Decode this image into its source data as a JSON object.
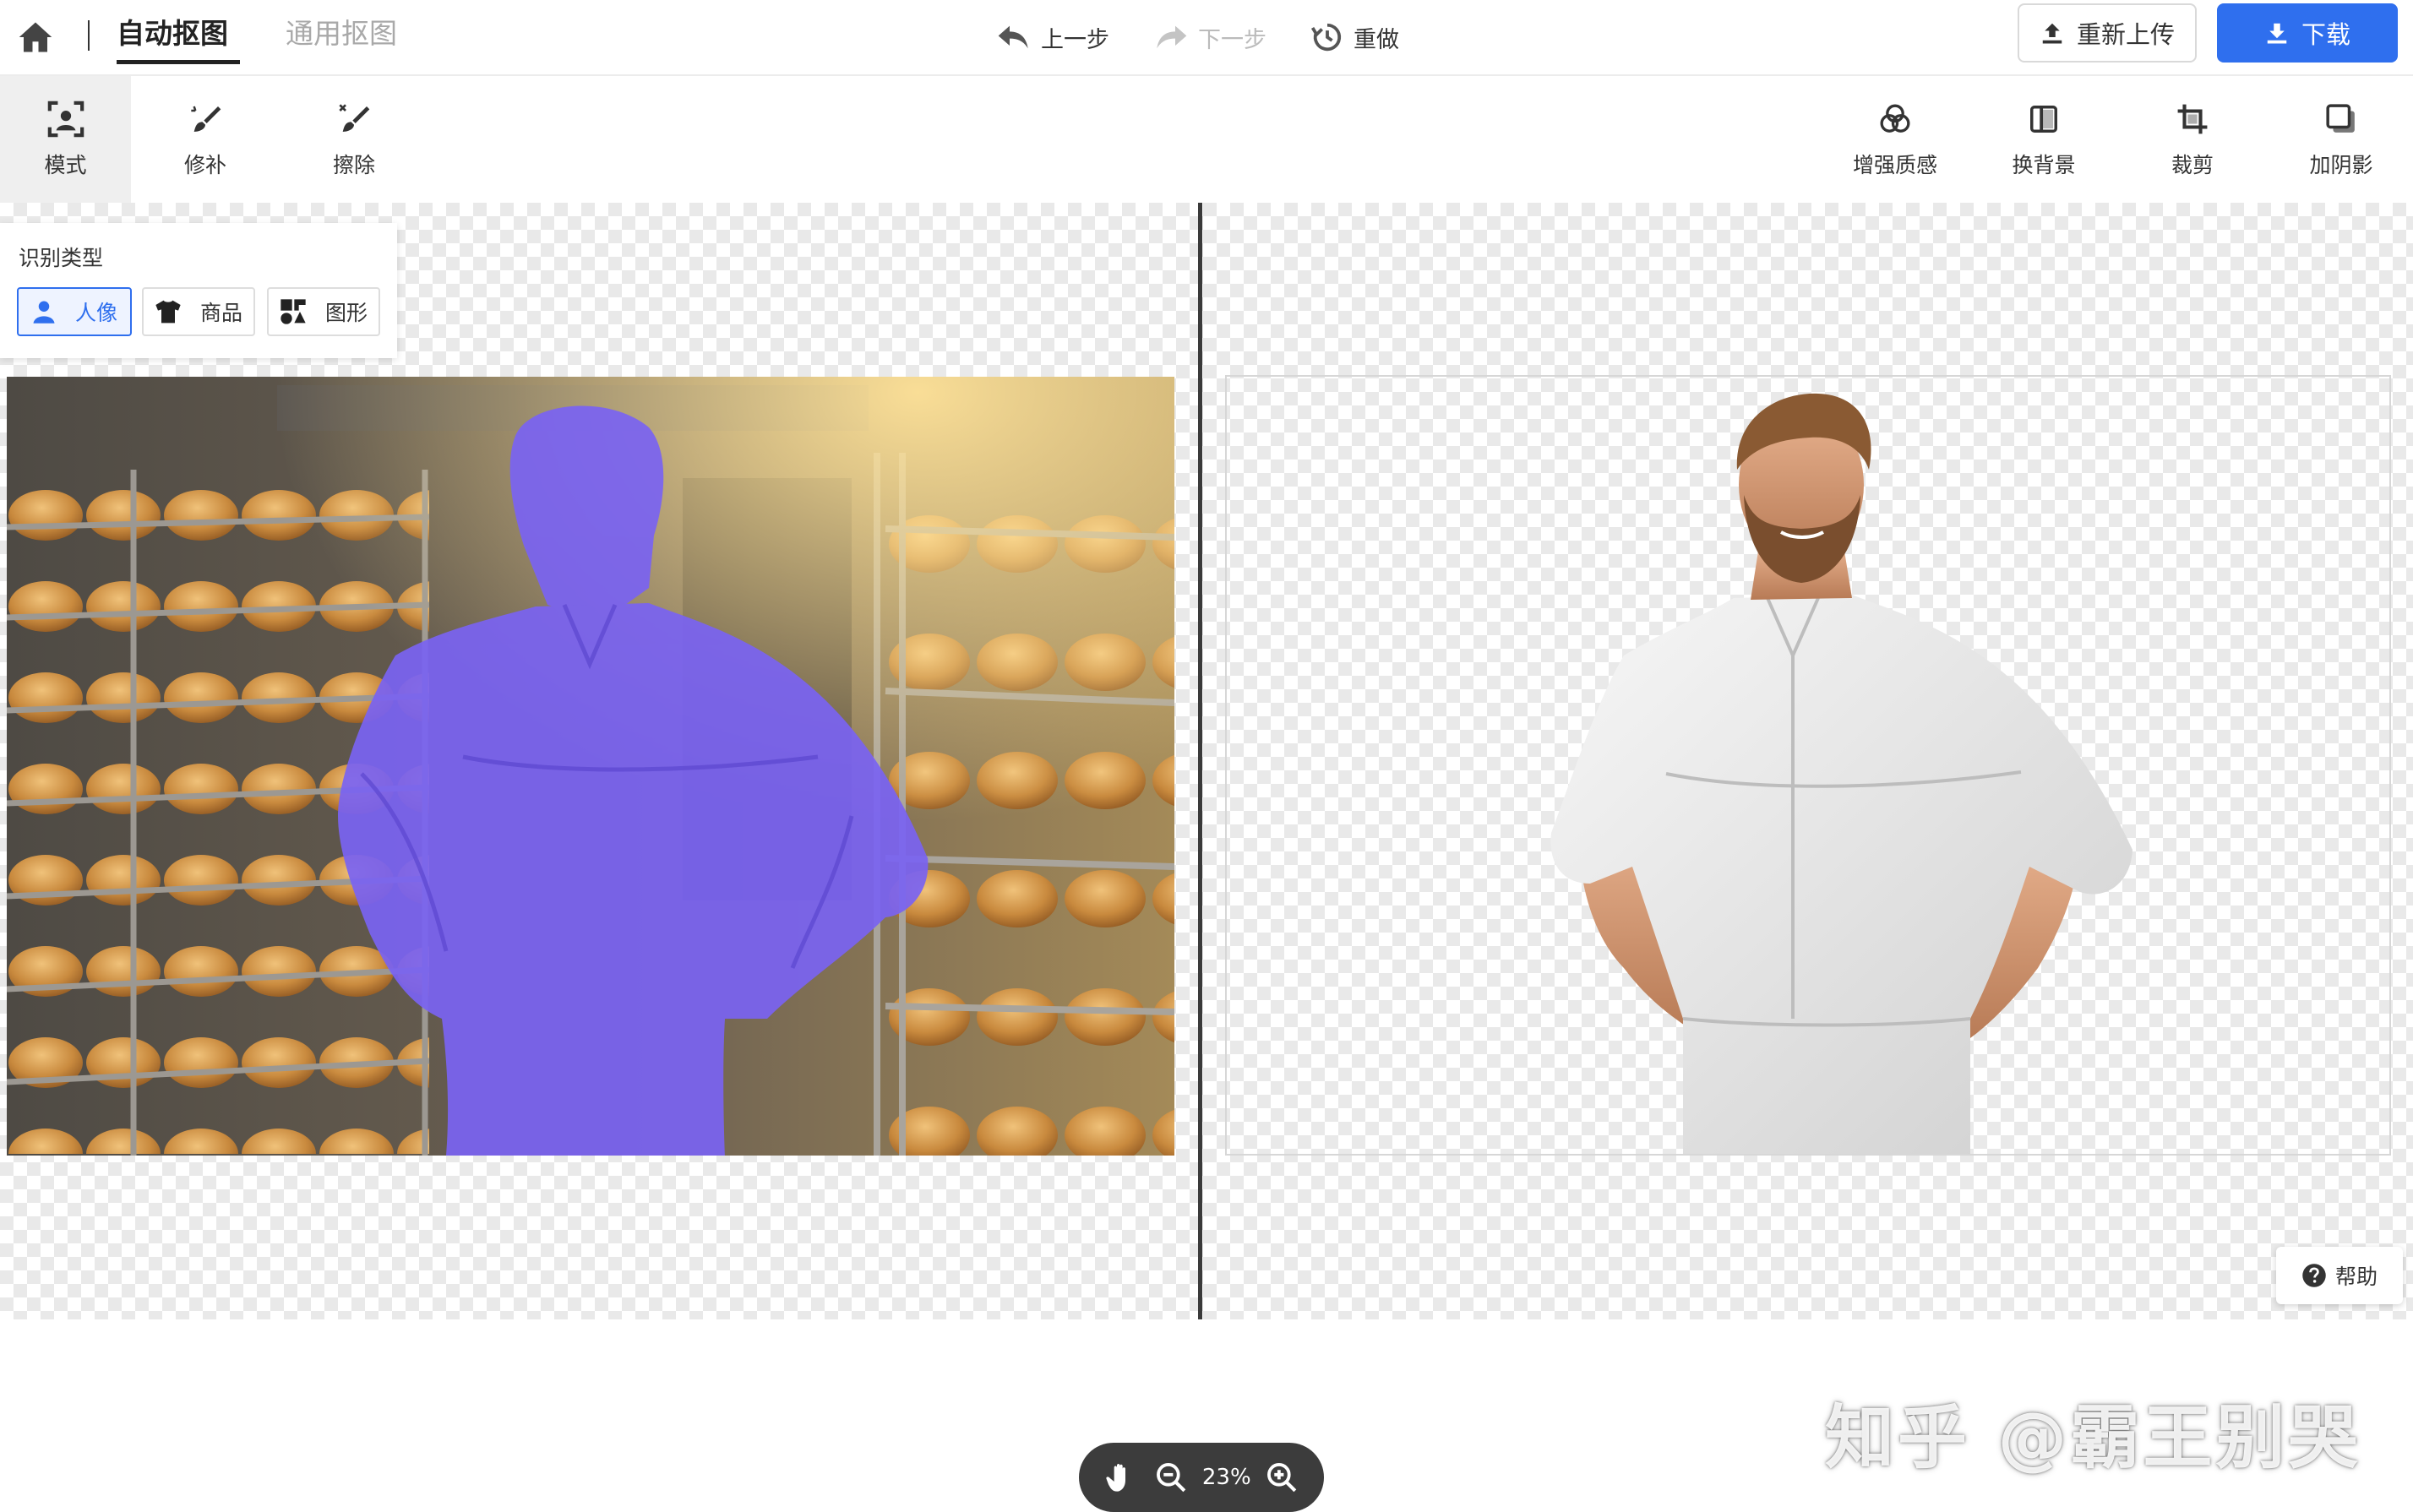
{
  "header": {
    "tabs": [
      {
        "label": "自动抠图",
        "active": true
      },
      {
        "label": "通用抠图",
        "active": false
      }
    ],
    "undo_label": "上一步",
    "redo_label": "下一步",
    "reset_label": "重做",
    "reupload_label": "重新上传",
    "download_label": "下载",
    "accent_color": "#2f6fee"
  },
  "toolbar": {
    "left_tools": [
      {
        "label": "模式",
        "icon": "portrait-mode-icon",
        "active": true
      },
      {
        "label": "修补",
        "icon": "brush-icon"
      },
      {
        "label": "擦除",
        "icon": "eraser-icon"
      }
    ],
    "right_tools": [
      {
        "label": "增强质感",
        "icon": "enhance-icon"
      },
      {
        "label": "换背景",
        "icon": "background-icon"
      },
      {
        "label": "裁剪",
        "icon": "crop-icon"
      },
      {
        "label": "加阴影",
        "icon": "shadow-icon"
      }
    ]
  },
  "recognition": {
    "title": "识别类型",
    "options": [
      {
        "label": "人像",
        "icon": "person-icon",
        "active": true
      },
      {
        "label": "商品",
        "icon": "shirt-icon"
      },
      {
        "label": "图形",
        "icon": "shapes-icon"
      }
    ]
  },
  "canvas": {
    "subject_highlight_color": "#7a63f2",
    "zoom_level": "23%"
  },
  "watermark": "知乎 @霸王别哭",
  "help_label": "帮助"
}
